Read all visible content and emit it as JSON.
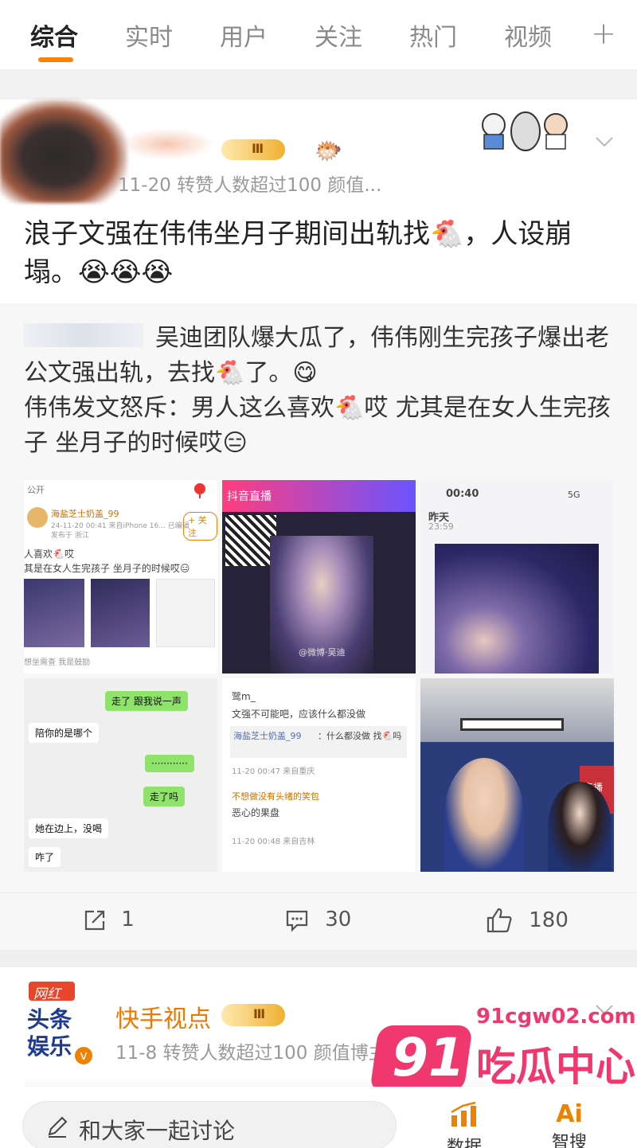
{
  "tabs": [
    {
      "label": "综合",
      "active": true
    },
    {
      "label": "实时",
      "active": false
    },
    {
      "label": "用户",
      "active": false
    },
    {
      "label": "关注",
      "active": false
    },
    {
      "label": "热门",
      "active": false
    },
    {
      "label": "视频",
      "active": false
    }
  ],
  "tab_add": "+",
  "post1": {
    "meta": "11-20 转赞人数超过100 颜值...",
    "vip_level": "Ⅲ",
    "text": "浪子文强在伟伟坐月子期间出轨找🐔，人设崩塌。😭😭😭",
    "repost_text_line1": "吴迪团队爆大瓜了，伟伟刚生完孩子爆出老公文强出轨，去找🐔了。😋",
    "repost_text_line2": "伟伟发文怒斥：男人这么喜欢🐔哎 尤其是在女人生完孩子 坐月子的时候哎😑",
    "images": {
      "c1": {
        "public_tag": "公开",
        "user": "海盐芝士奶盖_99",
        "time": "24-11-20 00:41 来自iPhone 16... 已编辑",
        "location": "发布于 浙江",
        "follow": "+ 关注",
        "line1": "人喜欢🐔哎",
        "line2": "其是在女人生完孩子 坐月子的时候哎😑",
        "footer": "想坐需查 我是鼓励"
      },
      "c2": {
        "text1": "抖音直播",
        "watermark": "@微博·吴迪"
      },
      "c3": {
        "time": "00:40",
        "signal": "5G",
        "label": "昨天",
        "sub": "23:59"
      },
      "c4": {
        "msg1": "走了 跟我说一声",
        "msg2": "陪你的是哪个",
        "msg3": "············",
        "msg4": "走了吗",
        "msg5": "她在边上，没喝",
        "msg6": "咋了"
      },
      "c5": {
        "user": "鹭m_",
        "line1": "文强不可能吧，应该什么都没做",
        "reply_user": "海盐芝士奶盖_99",
        "reply": "：什么都没做 找🐔吗",
        "time1": "11-20 00:47 来自重庆",
        "user2": "不想做没有头绪的笑包",
        "line2": "恶心的果盘",
        "time2": "11-20 00:48 来自吉林"
      },
      "c6": {
        "sign": "直播"
      }
    },
    "actions": {
      "repost": "1",
      "comment": "30",
      "like": "180"
    }
  },
  "post2": {
    "avatar_text1": "网红",
    "avatar_text2": "头条",
    "avatar_text3": "娱乐",
    "name": "快手视点",
    "vip_level": "Ⅲ",
    "meta": "11-8 转赞人数超过100 颜值博主"
  },
  "watermark": {
    "domain": "91cgw02.com",
    "number": "91",
    "title": "吃瓜中心"
  },
  "bottom": {
    "comment_placeholder": "和大家一起讨论",
    "btn1": "数据",
    "btn2": "智搜"
  },
  "colors": {
    "accent": "#ff8200",
    "brand_orange": "#f07800",
    "like_gray": "#555555",
    "watermark_pink": "#f0386e"
  }
}
